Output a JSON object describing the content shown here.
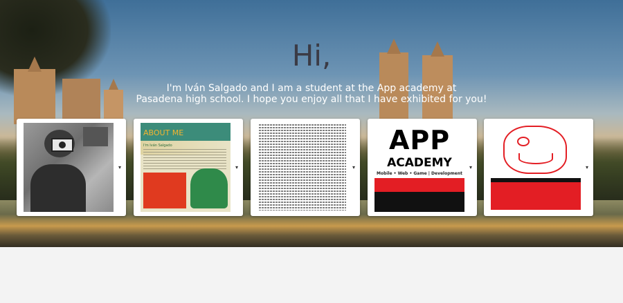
{
  "hero": {
    "greeting": "Hi,",
    "intro_line1": "I'm Iván Salgado and I am a student at the App academy at",
    "intro_line2": "Pasadena high school. I hope you enjoy all that I have exhibited for you!"
  },
  "gallery": {
    "caret_glyph": "▾",
    "cards": [
      {
        "subject": "photo of person holding camera"
      },
      {
        "subject": "about me poster",
        "heading": "ABOUT ME",
        "name": "I'm Iván Salgado"
      },
      {
        "subject": "source code screenshot"
      },
      {
        "subject": "app academy logo",
        "line1": "APP",
        "line2": "ACADEMY",
        "tagline": "Mobile • Web • Game | Development"
      },
      {
        "subject": "bulldog mascot logo"
      }
    ]
  },
  "colors": {
    "title": "#3b3b45",
    "intro_text": "#ffffff",
    "accent_red": "#e31e24",
    "footer_bg": "#f3f3f3"
  }
}
